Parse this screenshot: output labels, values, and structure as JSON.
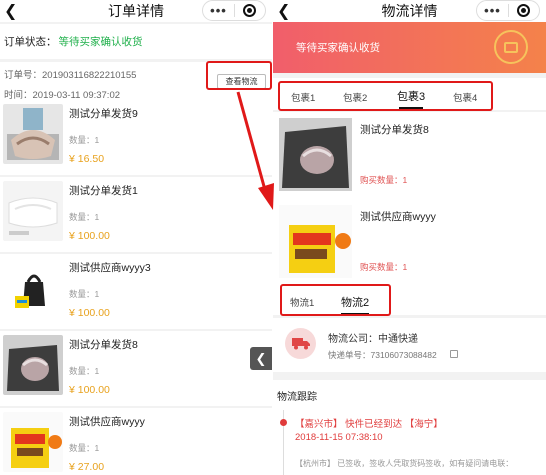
{
  "left": {
    "title": "订单详情",
    "status_label": "订单状态：",
    "status_value": "等待买家确认收货",
    "order_no": "订单号：201903116822210155",
    "time": "时间：2019-03-11 09:37:02",
    "btn_logistics": "查看物流",
    "items": [
      {
        "name": "测试分单发货9",
        "qty": "数量：1",
        "price": "¥ 16.50"
      },
      {
        "name": "测试分单发货1",
        "qty": "数量：1",
        "price": "¥ 100.00"
      },
      {
        "name": "测试供应商wyyy3",
        "qty": "数量：1",
        "price": "¥ 100.00"
      },
      {
        "name": "测试分单发货8",
        "qty": "数量：1",
        "price": "¥ 100.00"
      },
      {
        "name": "测试供应商wyyy",
        "qty": "数量：1",
        "price": "¥ 27.00"
      }
    ]
  },
  "right": {
    "title": "物流详情",
    "banner_status": "等待买家确认收货",
    "package_tabs": [
      "包裹1",
      "包裹2",
      "包裹3",
      "包裹4"
    ],
    "active_package": "包裹3",
    "products": [
      {
        "name": "测试分单发货8",
        "qty": "购买数量：1"
      },
      {
        "name": "测试供应商wyyy",
        "qty": "购买数量：1"
      }
    ],
    "logistics_tabs": [
      "物流1",
      "物流2"
    ],
    "active_logistics": "物流2",
    "courier_company": "物流公司：中通快递",
    "tracking_no": "快递单号：73106073088482",
    "tracking_header": "物流跟踪",
    "events": [
      {
        "text": "【嘉兴市】 快件已经到达 【海宁】",
        "time": "2018-11-15 07:38:10"
      },
      {
        "text": "【杭州市】 已签收，签收人凭取货码签收，如有疑问请电联："
      }
    ]
  },
  "icons": {
    "back": "chevron-left-icon",
    "more": "more-dots-icon",
    "target": "target-icon",
    "truck": "truck-icon",
    "copy": "copy-icon",
    "stamp": "delivery-stamp-icon"
  },
  "colors": {
    "status_green": "#20b04b",
    "price_orange": "#e8a21e",
    "annotation_red": "#e01919",
    "banner_start": "#f15e6b",
    "banner_end": "#f4824a"
  }
}
